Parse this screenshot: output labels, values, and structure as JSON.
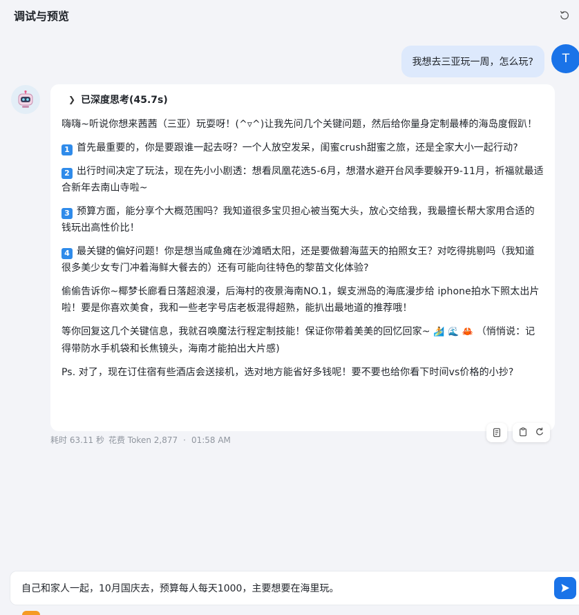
{
  "header": {
    "title": "调试与预览"
  },
  "user_message": {
    "text": "我想去三亚玩一周，怎么玩?",
    "avatar_letter": "T"
  },
  "bot": {
    "thinking_label": "已深度思考(45.7s)",
    "paragraphs": [
      "嗨嗨~听说你想来茜茜（三亚）玩耍呀！(^▿^)让我先问几个关键问题，然后给你量身定制最棒的海岛度假趴！",
      "首先最重要的，你是要跟谁一起去呀？一个人放空发呆，闺蜜crush甜蜜之旅，还是全家大小一起行动?",
      "出行时间决定了玩法，现在先小小剧透：想看凤凰花选5-6月，想潜水避开台风季要躲开9-11月，祈福就最适合新年去南山寺啦~",
      "预算方面，能分享个大概范围吗？我知道很多宝贝担心被当冤大头，放心交给我，我最擅长帮大家用合适的钱玩出高性价比！",
      "最关键的偏好问题！你是想当咸鱼瘫在沙滩晒太阳，还是要做碧海蓝天的拍照女王？对吃得挑剔吗（我知道很多美少女专门冲着海鲜大餐去的）还有可能向往特色的黎苗文化体验?",
      "偷偷告诉你~椰梦长廊看日落超浪漫，后海村的夜景海南NO.1，蜈支洲岛的海底漫步给 iphone拍水下照太出片啦！要是你喜欢美食，我和一些老字号店老板混得超熟，能扒出最地道的推荐哦！",
      "等你回复这几个关键信息，我就召唤魔法行程定制技能！保证你带着美美的回忆回家~",
      "（悄悄说：记得带防水手机袋和长焦镜头，海南才能拍出大片感)",
      "Ps. 对了，现在订住宿有些酒店会送接机，选对地方能省好多钱呢！要不要也给你看下时间vs价格的小抄?"
    ],
    "badges": [
      "1",
      "2",
      "3",
      "4"
    ],
    "emoji": [
      "🏄",
      "🌊",
      "🦀"
    ]
  },
  "meta": {
    "duration": "耗时 63.11 秒",
    "tokens": "花费 Token 2,877",
    "sep": "·",
    "time": "01:58 AM"
  },
  "input": {
    "value": "自己和家人一起，10月国庆去，预算每人每天1000，主要想要在海里玩。"
  },
  "icons": {
    "refresh": "refresh-icon",
    "send": "send-icon",
    "chevron": "chevron-right-icon",
    "document": "document-icon",
    "copy": "copy-icon",
    "regenerate": "regenerate-icon"
  },
  "colors": {
    "accent": "#1a73e8",
    "user_bubble": "#dde9fc",
    "badge": "#2f8bea"
  }
}
